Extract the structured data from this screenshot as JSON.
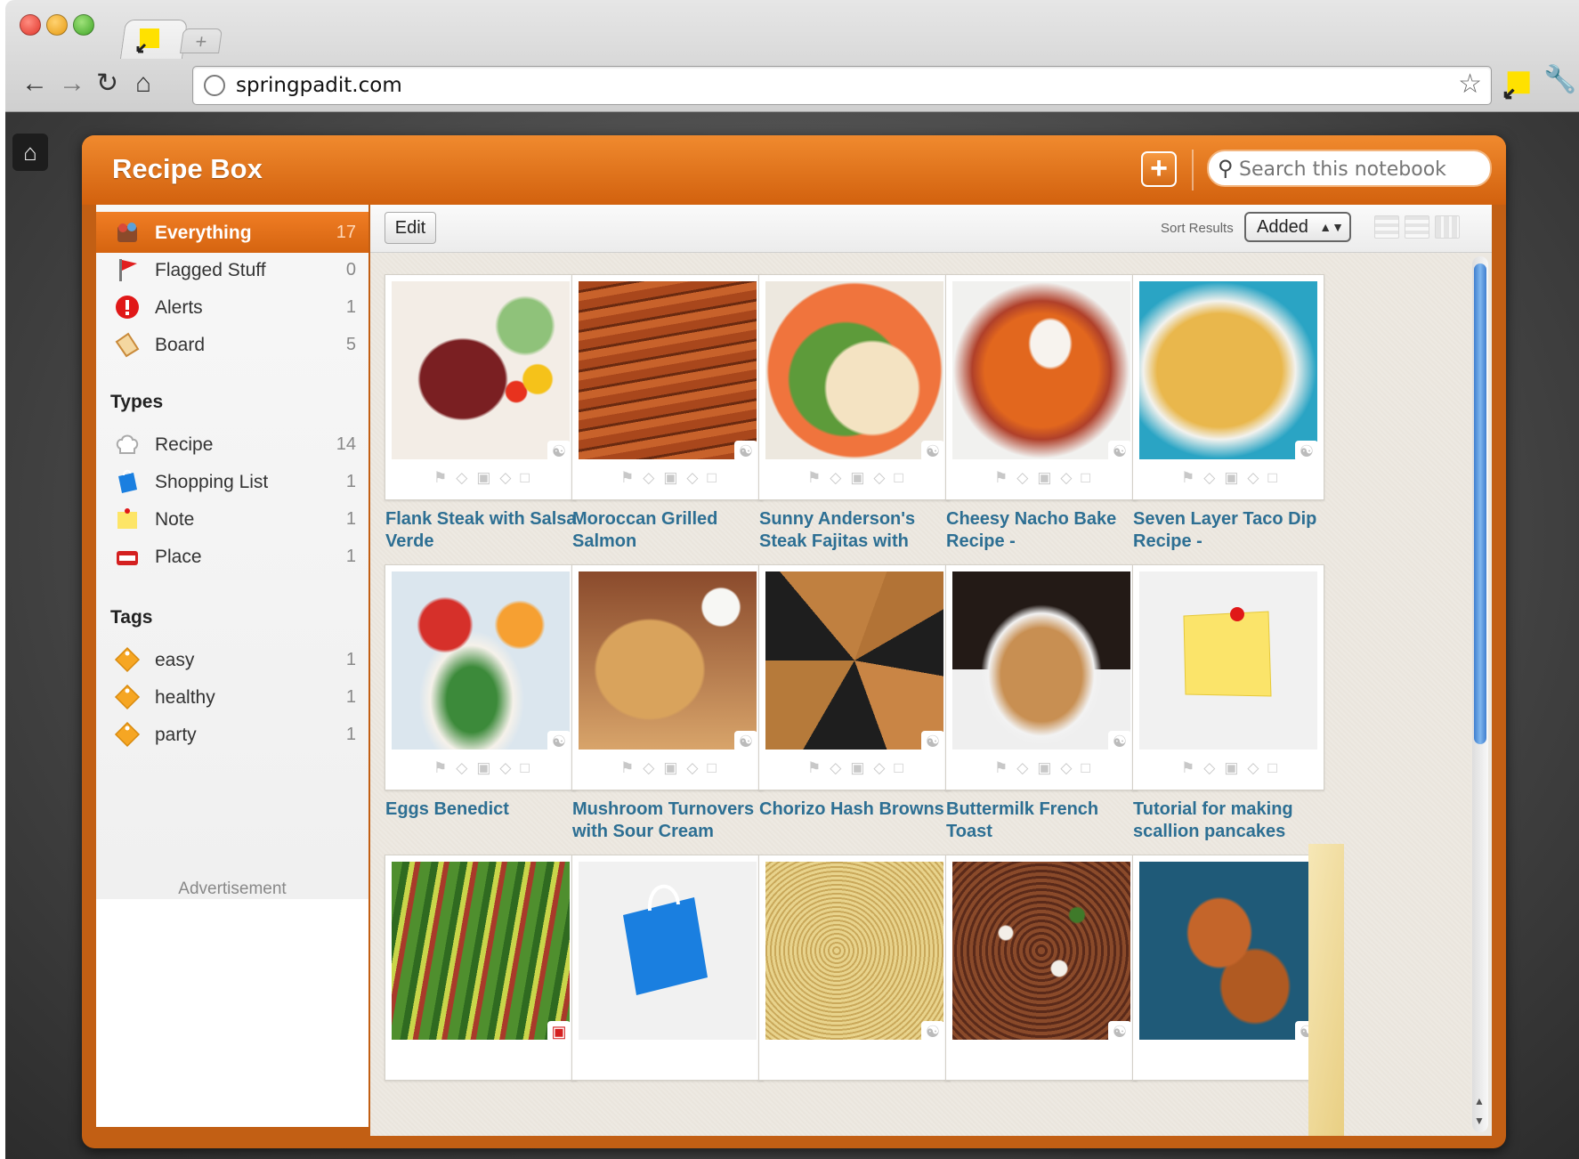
{
  "browser": {
    "url": "springpadit.com",
    "new_tab_label": "+"
  },
  "app": {
    "title": "Recipe Box",
    "add_label": "+",
    "search_placeholder": "Search this notebook"
  },
  "sidebar": {
    "items": [
      {
        "label": "Everything",
        "count": "17",
        "icon": "everything-icon"
      },
      {
        "label": "Flagged Stuff",
        "count": "0",
        "icon": "flag-icon"
      },
      {
        "label": "Alerts",
        "count": "1",
        "icon": "alert-icon"
      },
      {
        "label": "Board",
        "count": "5",
        "icon": "board-icon"
      }
    ],
    "types_heading": "Types",
    "types": [
      {
        "label": "Recipe",
        "count": "14",
        "icon": "chef-hat-icon"
      },
      {
        "label": "Shopping List",
        "count": "1",
        "icon": "shopping-bag-icon"
      },
      {
        "label": "Note",
        "count": "1",
        "icon": "note-icon"
      },
      {
        "label": "Place",
        "count": "1",
        "icon": "open-sign-icon"
      }
    ],
    "tags_heading": "Tags",
    "tags": [
      {
        "label": "easy",
        "count": "1",
        "icon": "tag-icon"
      },
      {
        "label": "healthy",
        "count": "1",
        "icon": "tag-icon"
      },
      {
        "label": "party",
        "count": "1",
        "icon": "tag-icon"
      }
    ],
    "advertisement": "Advertisement"
  },
  "toolbar": {
    "edit_label": "Edit",
    "sort_label": "Sort Results",
    "sort_value": "Added"
  },
  "cards": [
    {
      "title": "Flank Steak with Salsa Verde"
    },
    {
      "title": "Moroccan Grilled Salmon"
    },
    {
      "title": "Sunny Anderson's Steak Fajitas with"
    },
    {
      "title": "Cheesy Nacho Bake Recipe -"
    },
    {
      "title": "Seven Layer Taco Dip Recipe -"
    },
    {
      "title": "Eggs Benedict"
    },
    {
      "title": "Mushroom Turnovers with Sour Cream"
    },
    {
      "title": "Chorizo Hash Browns"
    },
    {
      "title": "Buttermilk French Toast"
    },
    {
      "title": "Tutorial for making scallion pancakes"
    },
    {
      "title": ""
    },
    {
      "title": ""
    },
    {
      "title": ""
    },
    {
      "title": ""
    },
    {
      "title": ""
    }
  ],
  "card_action_badge": "1",
  "colors": {
    "brand_orange": "#e0701a",
    "link_blue": "#2d6f93"
  }
}
